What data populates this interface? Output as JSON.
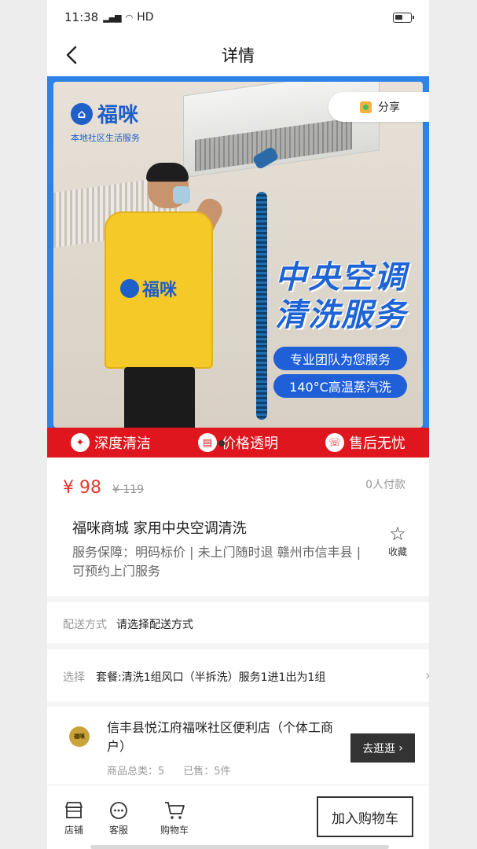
{
  "status_bar": {
    "time": "11:38",
    "network": "HD"
  },
  "nav": {
    "title": "详情"
  },
  "banner": {
    "brand_name": "福咪",
    "brand_subtitle": "本地社区生活服务",
    "share_label": "分享",
    "vest_brand": "福咪",
    "headline_line1": "中央空调",
    "headline_line2": "清洗服务",
    "tag1": "专业团队为您服务",
    "tag2": "140°C高温蒸汽洗",
    "features": [
      {
        "label": "深度清洁",
        "icon": "sparkle-icon"
      },
      {
        "label": "价格透明",
        "icon": "receipt-icon"
      },
      {
        "label": "售后无忧",
        "icon": "headset-icon"
      }
    ]
  },
  "price": {
    "current": "¥ 98",
    "original": "¥ 119",
    "paid_count": "0人付款"
  },
  "product": {
    "title": "福咪商城 家用中央空调清洗",
    "guarantee": "服务保障：明码标价 | 未上门随时退 赣州市信丰县 | 可预约上门服务",
    "favorite_label": "收藏"
  },
  "delivery": {
    "label": "配送方式",
    "value": "请选择配送方式"
  },
  "option": {
    "label": "选择",
    "value": "套餐:清洗1组风口（半拆洗）服务1进1出为1组"
  },
  "store": {
    "logo_text": "福咪",
    "name": "信丰县悦江府福咪社区便利店（个体工商户）",
    "category_label": "商品总类：5",
    "sold_label": "已售：5件",
    "visit_button": "去逛逛"
  },
  "bottom_bar": {
    "store_label": "店铺",
    "service_label": "客服",
    "cart_label": "购物车",
    "add_to_cart": "加入购物车"
  },
  "colors": {
    "accent_red": "#e0161f",
    "price_red": "#e23b2e",
    "brand_blue": "#1f5fc8",
    "vest_yellow": "#f5c928",
    "dark_button": "#333333"
  }
}
